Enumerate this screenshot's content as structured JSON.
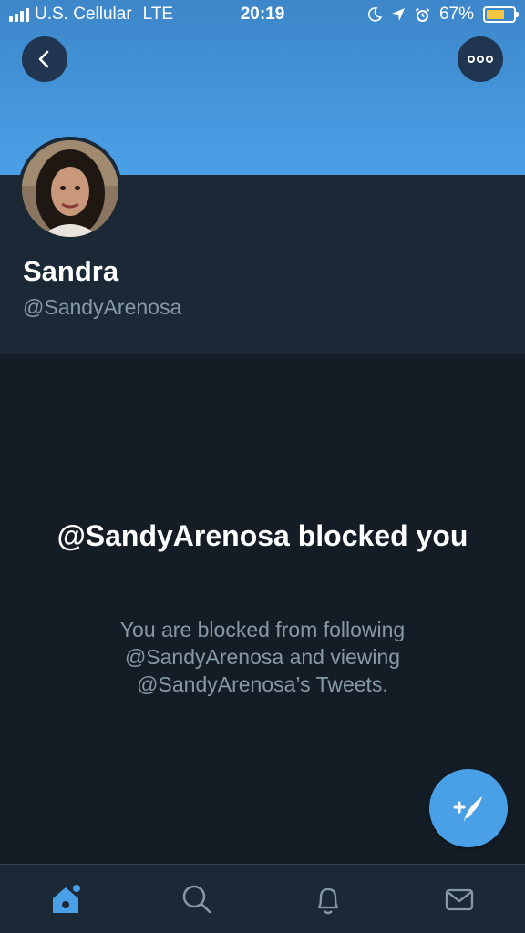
{
  "status_bar": {
    "carrier": "U.S. Cellular",
    "network": "LTE",
    "time": "20:19",
    "battery": "67%",
    "battery_level": 0.67,
    "icons": [
      "moon-icon",
      "location-arrow-icon",
      "alarm-icon",
      "battery-icon"
    ]
  },
  "header": {
    "back_icon": "chevron-left-icon",
    "more_icon": "more-horizontal-icon",
    "banner_color": "#4aa0e6"
  },
  "profile": {
    "name": "Sandra",
    "handle": "@SandyArenosa"
  },
  "blocked": {
    "title": "@SandyArenosa blocked you",
    "description": "You are blocked from following @SandyArenosa and viewing @SandyArenosa’s Tweets."
  },
  "fab": {
    "icon": "compose-tweet-icon",
    "color": "#4aa0e6"
  },
  "tabbar": {
    "items": [
      {
        "icon": "home-icon",
        "active": true
      },
      {
        "icon": "search-icon",
        "active": false
      },
      {
        "icon": "notifications-bell-icon",
        "active": false
      },
      {
        "icon": "messages-envelope-icon",
        "active": false
      }
    ],
    "active_color": "#4aa0e6",
    "inactive_color": "#8899a6"
  },
  "colors": {
    "background": "#141d26",
    "surface": "#1b2836",
    "secondary_text": "#8899a6"
  }
}
